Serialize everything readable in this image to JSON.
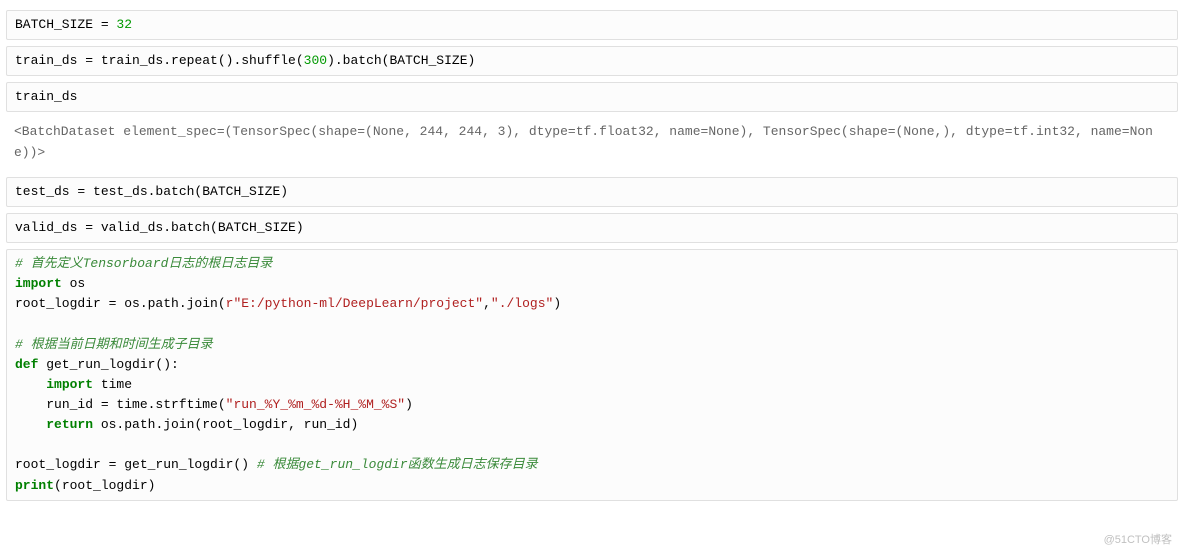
{
  "cell1": {
    "var": "BATCH_SIZE",
    "eq": " = ",
    "val": "32"
  },
  "cell2": {
    "lhs": "train_ds",
    "eq": " = ",
    "p1": "train_ds.repeat().shuffle(",
    "n1": "300",
    "p2": ").batch(BATCH_SIZE)"
  },
  "cell3": {
    "code": "train_ds"
  },
  "out3": {
    "text": "<BatchDataset element_spec=(TensorSpec(shape=(None, 244, 244, 3), dtype=tf.float32, name=None), TensorSpec(shape=(None,), dtype=tf.int32, name=None))>"
  },
  "cell4": {
    "lhs": "test_ds",
    "eq": " = ",
    "rhs": "test_ds.batch(BATCH_SIZE)"
  },
  "cell5": {
    "lhs": "valid_ds",
    "eq": " = ",
    "rhs": "valid_ds.batch(BATCH_SIZE)"
  },
  "cell6": {
    "c1": "# 首先定义Tensorboard日志的根日志目录",
    "kw_import1": "import",
    "mod1": " os",
    "l3a": "root_logdir = os.path.join(",
    "l3b": "r\"E:/python-ml/DeepLearn/project\"",
    "l3c": ",",
    "l3d": "\"./logs\"",
    "l3e": ")",
    "blank1": "",
    "c2": "# 根据当前日期和时间生成子目录",
    "kw_def": "def",
    "fn_name": " get_run_logdir():",
    "indent": "    ",
    "kw_import2": "import",
    "mod2": " time",
    "l8a": "    run_id = time.strftime(",
    "l8b": "\"run_%Y_%m_%d-%H_%M_%S\"",
    "l8c": ")",
    "kw_return": "return",
    "l9b": " os.path.join(root_logdir, run_id)",
    "blank2": "",
    "l11a": "root_logdir = get_run_logdir() ",
    "c3": "# 根据get_run_logdir函数生成日志保存目录",
    "kw_print": "print",
    "l12b": "(root_logdir)"
  },
  "watermark": "@51CTO博客"
}
